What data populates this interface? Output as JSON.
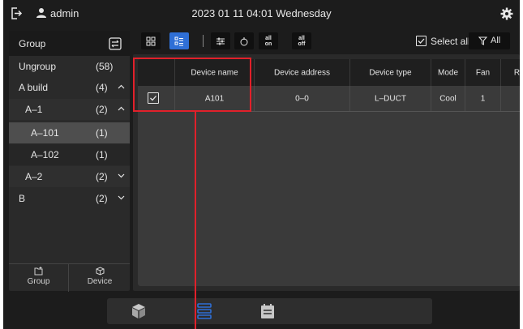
{
  "topbar": {
    "username": "admin",
    "datetime": "2023 01 11 04:01 Wednesday"
  },
  "sidebar": {
    "header_label": "Group",
    "items": [
      {
        "name": "Ungroup",
        "count": "(58)",
        "chevron": ""
      },
      {
        "name": "A build",
        "count": "(4)",
        "chevron": "up"
      },
      {
        "name": "A–1",
        "count": "(2)",
        "chevron": "up"
      },
      {
        "name": "A–101",
        "count": "(1)",
        "chevron": ""
      },
      {
        "name": "A–102",
        "count": "(1)",
        "chevron": ""
      },
      {
        "name": "A–2",
        "count": "(2)",
        "chevron": "down"
      },
      {
        "name": "B",
        "count": "(2)",
        "chevron": "down"
      }
    ],
    "footer": {
      "group_label": "Group",
      "device_label": "Device"
    }
  },
  "toolbar": {
    "all_on": [
      "all",
      "on"
    ],
    "all_off": [
      "all",
      "off"
    ],
    "select_all_label": "Select all",
    "filter_label": "All"
  },
  "table": {
    "columns": [
      "Device name",
      "Device address",
      "Device type",
      "Mode",
      "Fan",
      "R"
    ],
    "rows": [
      {
        "checked": true,
        "device_name": "A101",
        "device_address": "0–0",
        "device_type": "L–DUCT",
        "mode": "Cool",
        "fan": "1"
      }
    ]
  },
  "colors": {
    "accent": "#2f6fd6",
    "highlight": "#e1202a",
    "background": "#1c1c1c"
  }
}
